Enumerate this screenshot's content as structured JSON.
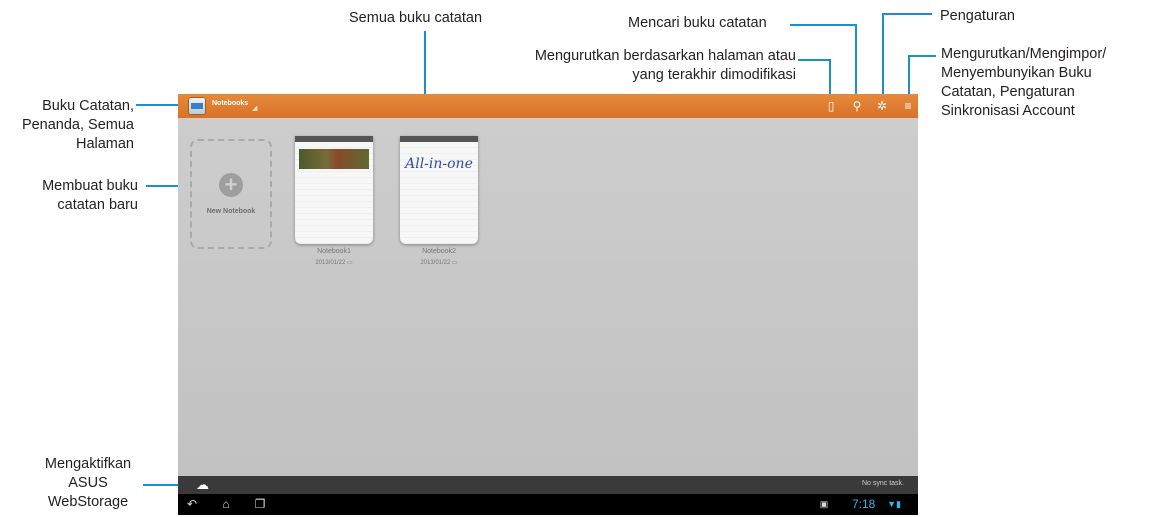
{
  "annotations": {
    "all_notebooks": "Semua buku catatan",
    "search_notebook": "Mencari buku catatan",
    "settings": "Pengaturan",
    "sort_line1": "Mengurutkan berdasarkan halaman atau",
    "sort_line2": "yang terakhir dimodifikasi",
    "menu_line1": "Mengurutkan/Mengimpor/",
    "menu_line2": "Menyembunyikan Buku",
    "menu_line3": "Catatan, Pengaturan",
    "menu_line4": "Sinkronisasi Account",
    "bookmarks_line1": "Buku Catatan,",
    "bookmarks_line2": "Penanda, Semua",
    "bookmarks_line3": "Halaman",
    "create_line1": "Membuat buku",
    "create_line2": "catatan baru",
    "webstorage_line1": "Mengaktifkan",
    "webstorage_line2": "ASUS",
    "webstorage_line3": "WebStorage"
  },
  "app": {
    "title": "Notebooks",
    "accent_color": "#e07d33",
    "new_notebook_label": "New Notebook",
    "notebooks": [
      {
        "name": "Notebook1",
        "date": "2013/01/22",
        "cover": "photo"
      },
      {
        "name": "Notebook2",
        "date": "2013/01/22",
        "cover_text": "All-in-one"
      }
    ],
    "sync_status": "No sync task.",
    "clock": "7:18",
    "toolbar_icons": [
      "sort-page-icon",
      "search-icon",
      "gear-icon",
      "menu-icon"
    ]
  },
  "highlight_color": "#1b8fd0"
}
